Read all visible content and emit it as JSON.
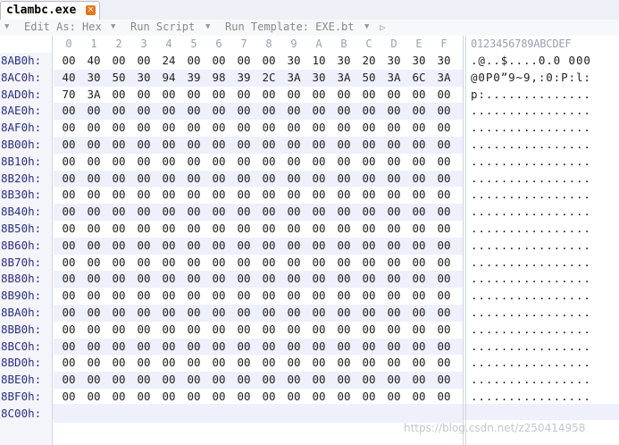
{
  "tab": {
    "title": "clambc.exe"
  },
  "toolbar": {
    "edit_as": "Edit As: Hex",
    "run_script": "Run Script",
    "run_template": "Run Template: EXE.bt"
  },
  "columns": [
    "0",
    "1",
    "2",
    "3",
    "4",
    "5",
    "6",
    "7",
    "8",
    "9",
    "A",
    "B",
    "C",
    "D",
    "E",
    "F"
  ],
  "ascii_header": "0123456789ABCDEF",
  "rows": [
    {
      "addr": "8AB0h:",
      "bytes": [
        "00",
        "40",
        "00",
        "00",
        "24",
        "00",
        "00",
        "00",
        "00",
        "30",
        "10",
        "30",
        "20",
        "30",
        "30",
        "30"
      ],
      "ascii": ".@..$....0.0 000"
    },
    {
      "addr": "8AC0h:",
      "bytes": [
        "40",
        "30",
        "50",
        "30",
        "94",
        "39",
        "98",
        "39",
        "2C",
        "3A",
        "30",
        "3A",
        "50",
        "3A",
        "6C",
        "3A"
      ],
      "ascii": "@0P0”9~9,:0:P:l:"
    },
    {
      "addr": "8AD0h:",
      "bytes": [
        "70",
        "3A",
        "00",
        "00",
        "00",
        "00",
        "00",
        "00",
        "00",
        "00",
        "00",
        "00",
        "00",
        "00",
        "00",
        "00"
      ],
      "ascii": "p:.............."
    },
    {
      "addr": "8AE0h:",
      "bytes": [
        "00",
        "00",
        "00",
        "00",
        "00",
        "00",
        "00",
        "00",
        "00",
        "00",
        "00",
        "00",
        "00",
        "00",
        "00",
        "00"
      ],
      "ascii": "................"
    },
    {
      "addr": "8AF0h:",
      "bytes": [
        "00",
        "00",
        "00",
        "00",
        "00",
        "00",
        "00",
        "00",
        "00",
        "00",
        "00",
        "00",
        "00",
        "00",
        "00",
        "00"
      ],
      "ascii": "................"
    },
    {
      "addr": "8B00h:",
      "bytes": [
        "00",
        "00",
        "00",
        "00",
        "00",
        "00",
        "00",
        "00",
        "00",
        "00",
        "00",
        "00",
        "00",
        "00",
        "00",
        "00"
      ],
      "ascii": "................"
    },
    {
      "addr": "8B10h:",
      "bytes": [
        "00",
        "00",
        "00",
        "00",
        "00",
        "00",
        "00",
        "00",
        "00",
        "00",
        "00",
        "00",
        "00",
        "00",
        "00",
        "00"
      ],
      "ascii": "................"
    },
    {
      "addr": "8B20h:",
      "bytes": [
        "00",
        "00",
        "00",
        "00",
        "00",
        "00",
        "00",
        "00",
        "00",
        "00",
        "00",
        "00",
        "00",
        "00",
        "00",
        "00"
      ],
      "ascii": "................"
    },
    {
      "addr": "8B30h:",
      "bytes": [
        "00",
        "00",
        "00",
        "00",
        "00",
        "00",
        "00",
        "00",
        "00",
        "00",
        "00",
        "00",
        "00",
        "00",
        "00",
        "00"
      ],
      "ascii": "................"
    },
    {
      "addr": "8B40h:",
      "bytes": [
        "00",
        "00",
        "00",
        "00",
        "00",
        "00",
        "00",
        "00",
        "00",
        "00",
        "00",
        "00",
        "00",
        "00",
        "00",
        "00"
      ],
      "ascii": "................"
    },
    {
      "addr": "8B50h:",
      "bytes": [
        "00",
        "00",
        "00",
        "00",
        "00",
        "00",
        "00",
        "00",
        "00",
        "00",
        "00",
        "00",
        "00",
        "00",
        "00",
        "00"
      ],
      "ascii": "................"
    },
    {
      "addr": "8B60h:",
      "bytes": [
        "00",
        "00",
        "00",
        "00",
        "00",
        "00",
        "00",
        "00",
        "00",
        "00",
        "00",
        "00",
        "00",
        "00",
        "00",
        "00"
      ],
      "ascii": "................"
    },
    {
      "addr": "8B70h:",
      "bytes": [
        "00",
        "00",
        "00",
        "00",
        "00",
        "00",
        "00",
        "00",
        "00",
        "00",
        "00",
        "00",
        "00",
        "00",
        "00",
        "00"
      ],
      "ascii": "................"
    },
    {
      "addr": "8B80h:",
      "bytes": [
        "00",
        "00",
        "00",
        "00",
        "00",
        "00",
        "00",
        "00",
        "00",
        "00",
        "00",
        "00",
        "00",
        "00",
        "00",
        "00"
      ],
      "ascii": "................"
    },
    {
      "addr": "8B90h:",
      "bytes": [
        "00",
        "00",
        "00",
        "00",
        "00",
        "00",
        "00",
        "00",
        "00",
        "00",
        "00",
        "00",
        "00",
        "00",
        "00",
        "00"
      ],
      "ascii": "................"
    },
    {
      "addr": "8BA0h:",
      "bytes": [
        "00",
        "00",
        "00",
        "00",
        "00",
        "00",
        "00",
        "00",
        "00",
        "00",
        "00",
        "00",
        "00",
        "00",
        "00",
        "00"
      ],
      "ascii": "................"
    },
    {
      "addr": "8BB0h:",
      "bytes": [
        "00",
        "00",
        "00",
        "00",
        "00",
        "00",
        "00",
        "00",
        "00",
        "00",
        "00",
        "00",
        "00",
        "00",
        "00",
        "00"
      ],
      "ascii": "................"
    },
    {
      "addr": "8BC0h:",
      "bytes": [
        "00",
        "00",
        "00",
        "00",
        "00",
        "00",
        "00",
        "00",
        "00",
        "00",
        "00",
        "00",
        "00",
        "00",
        "00",
        "00"
      ],
      "ascii": "................"
    },
    {
      "addr": "8BD0h:",
      "bytes": [
        "00",
        "00",
        "00",
        "00",
        "00",
        "00",
        "00",
        "00",
        "00",
        "00",
        "00",
        "00",
        "00",
        "00",
        "00",
        "00"
      ],
      "ascii": "................"
    },
    {
      "addr": "8BE0h:",
      "bytes": [
        "00",
        "00",
        "00",
        "00",
        "00",
        "00",
        "00",
        "00",
        "00",
        "00",
        "00",
        "00",
        "00",
        "00",
        "00",
        "00"
      ],
      "ascii": "................"
    },
    {
      "addr": "8BF0h:",
      "bytes": [
        "00",
        "00",
        "00",
        "00",
        "00",
        "00",
        "00",
        "00",
        "00",
        "00",
        "00",
        "00",
        "00",
        "00",
        "00",
        "00"
      ],
      "ascii": "................"
    },
    {
      "addr": "8C00h:",
      "bytes": [],
      "ascii": ""
    }
  ],
  "watermark": "https://blog.csdn.net/z250414958",
  "colors": {
    "address": "#2a2f80",
    "header": "#9ba0b3",
    "alt_row": "#eef0fb",
    "close_icon": "#e4781f"
  }
}
